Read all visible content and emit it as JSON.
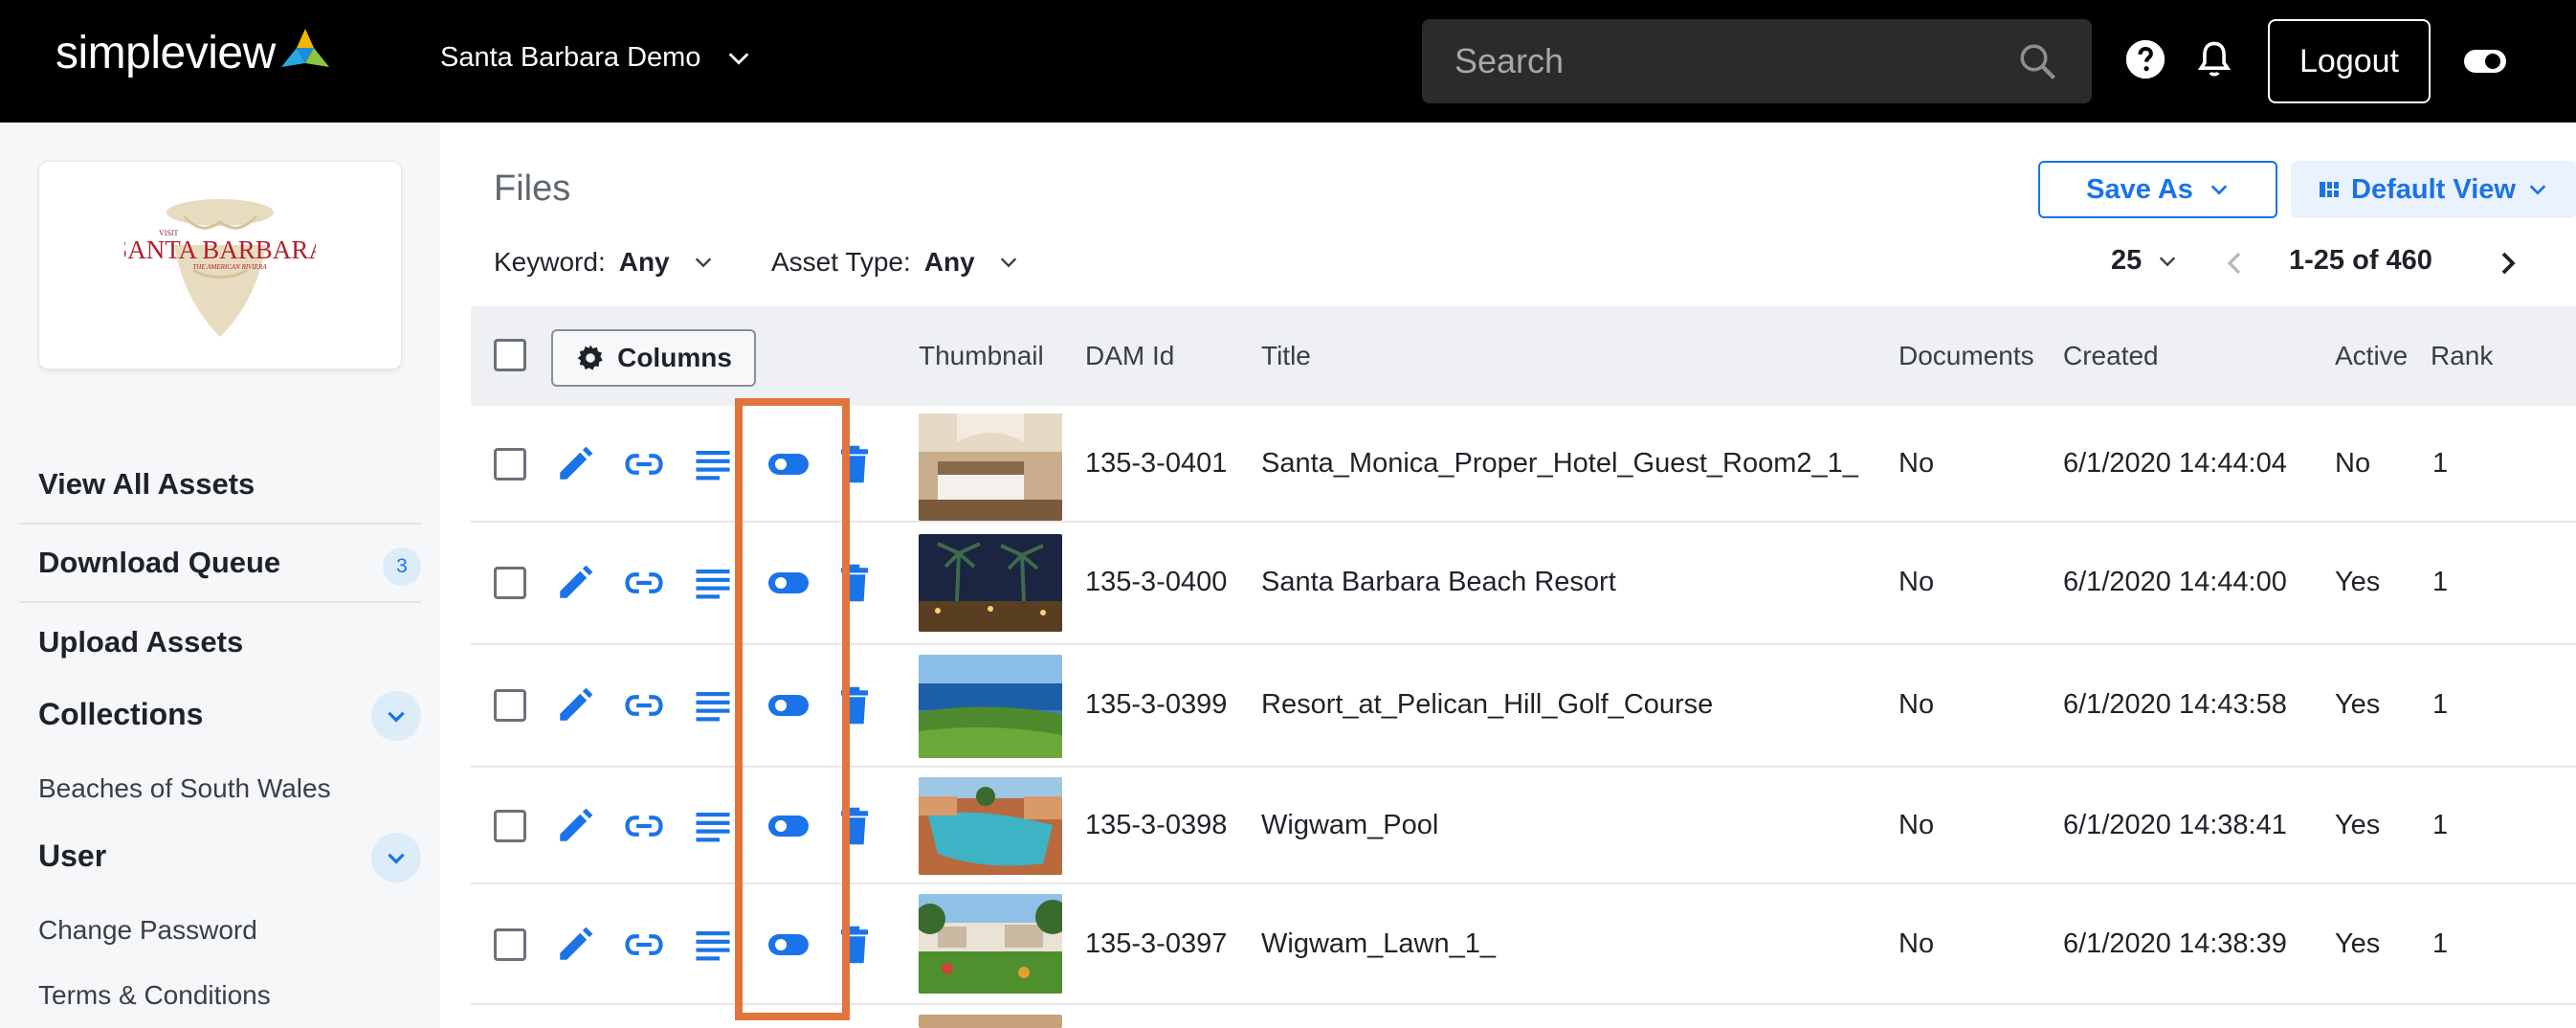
{
  "header": {
    "brand": "simpleview",
    "site_name": "Santa Barbara Demo",
    "search_placeholder": "Search",
    "logout_label": "Logout"
  },
  "sidebar": {
    "logo_alt_text": "Visit Santa Barbara - The American Riviera",
    "nav": [
      {
        "label": "View All Assets"
      },
      {
        "label": "Download Queue",
        "badge": "3"
      },
      {
        "label": "Upload Assets"
      }
    ],
    "collections": {
      "title": "Collections",
      "items": [
        "Beaches of South Wales"
      ]
    },
    "user": {
      "title": "User",
      "items": [
        "Change Password",
        "Terms & Conditions"
      ]
    }
  },
  "main": {
    "title": "Files",
    "save_as_label": "Save As",
    "default_view_label": "Default View",
    "filters": {
      "keyword_label": "Keyword:",
      "keyword_value": "Any",
      "asset_type_label": "Asset Type:",
      "asset_type_value": "Any"
    },
    "pager": {
      "per_page": "25",
      "range": "1-25 of 460"
    },
    "table": {
      "columns_button": "Columns",
      "headers": {
        "thumbnail": "Thumbnail",
        "dam_id": "DAM Id",
        "title": "Title",
        "documents": "Documents",
        "created": "Created",
        "active": "Active",
        "rank": "Rank"
      },
      "rows": [
        {
          "dam_id": "135-3-0401",
          "title": "Santa_Monica_Proper_Hotel_Guest_Room2_1_",
          "documents": "No",
          "created": "6/1/2020 14:44:04",
          "active": "No",
          "rank": "1",
          "thumb": "hotel-room"
        },
        {
          "dam_id": "135-3-0400",
          "title": "Santa Barbara Beach Resort",
          "documents": "No",
          "created": "6/1/2020 14:44:00",
          "active": "Yes",
          "rank": "1",
          "thumb": "palm-night"
        },
        {
          "dam_id": "135-3-0399",
          "title": "Resort_at_Pelican_Hill_Golf_Course",
          "documents": "No",
          "created": "6/1/2020 14:43:58",
          "active": "Yes",
          "rank": "1",
          "thumb": "golf-ocean"
        },
        {
          "dam_id": "135-3-0398",
          "title": "Wigwam_Pool",
          "documents": "No",
          "created": "6/1/2020 14:38:41",
          "active": "Yes",
          "rank": "1",
          "thumb": "resort-pool"
        },
        {
          "dam_id": "135-3-0397",
          "title": "Wigwam_Lawn_1_",
          "documents": "No",
          "created": "6/1/2020 14:38:39",
          "active": "Yes",
          "rank": "1",
          "thumb": "resort-lawn"
        }
      ]
    }
  },
  "colors": {
    "accent": "#1a73e8",
    "highlight": "#e2743e",
    "topbar": "#000000"
  },
  "icons": [
    "search-icon",
    "help-icon",
    "bell-icon",
    "toggle-icon",
    "chevron-down-icon",
    "gear-icon",
    "edit-icon",
    "link-icon",
    "details-icon",
    "trash-icon",
    "chevron-left-icon",
    "chevron-right-icon",
    "grid-view-icon"
  ]
}
